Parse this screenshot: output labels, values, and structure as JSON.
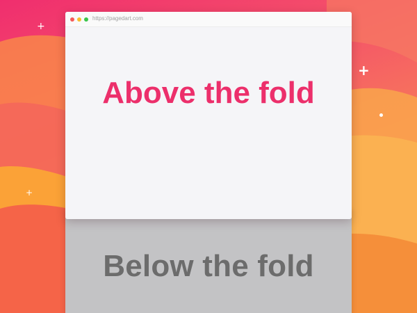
{
  "background": {
    "colors": [
      "#f02e6e",
      "#f77a5a",
      "#f99346",
      "#fbb046"
    ],
    "sparkles": [
      {
        "name": "sparkle-top-left",
        "glyph": "+"
      },
      {
        "name": "sparkle-right",
        "glyph": "+"
      },
      {
        "name": "sparkle-left-low",
        "glyph": "+"
      }
    ]
  },
  "browser": {
    "url": "https://pagedart.com",
    "traffic_lights": {
      "close_color": "#f55b58",
      "minimize_color": "#f9be2f",
      "zoom_color": "#3ac54a"
    },
    "headline": "Above the fold",
    "headline_color": "#ec2f6b",
    "background_color": "#f5f5f8"
  },
  "below": {
    "headline": "Below the fold",
    "headline_color": "#6c6c6c",
    "background_color": "#c3c3c5"
  }
}
